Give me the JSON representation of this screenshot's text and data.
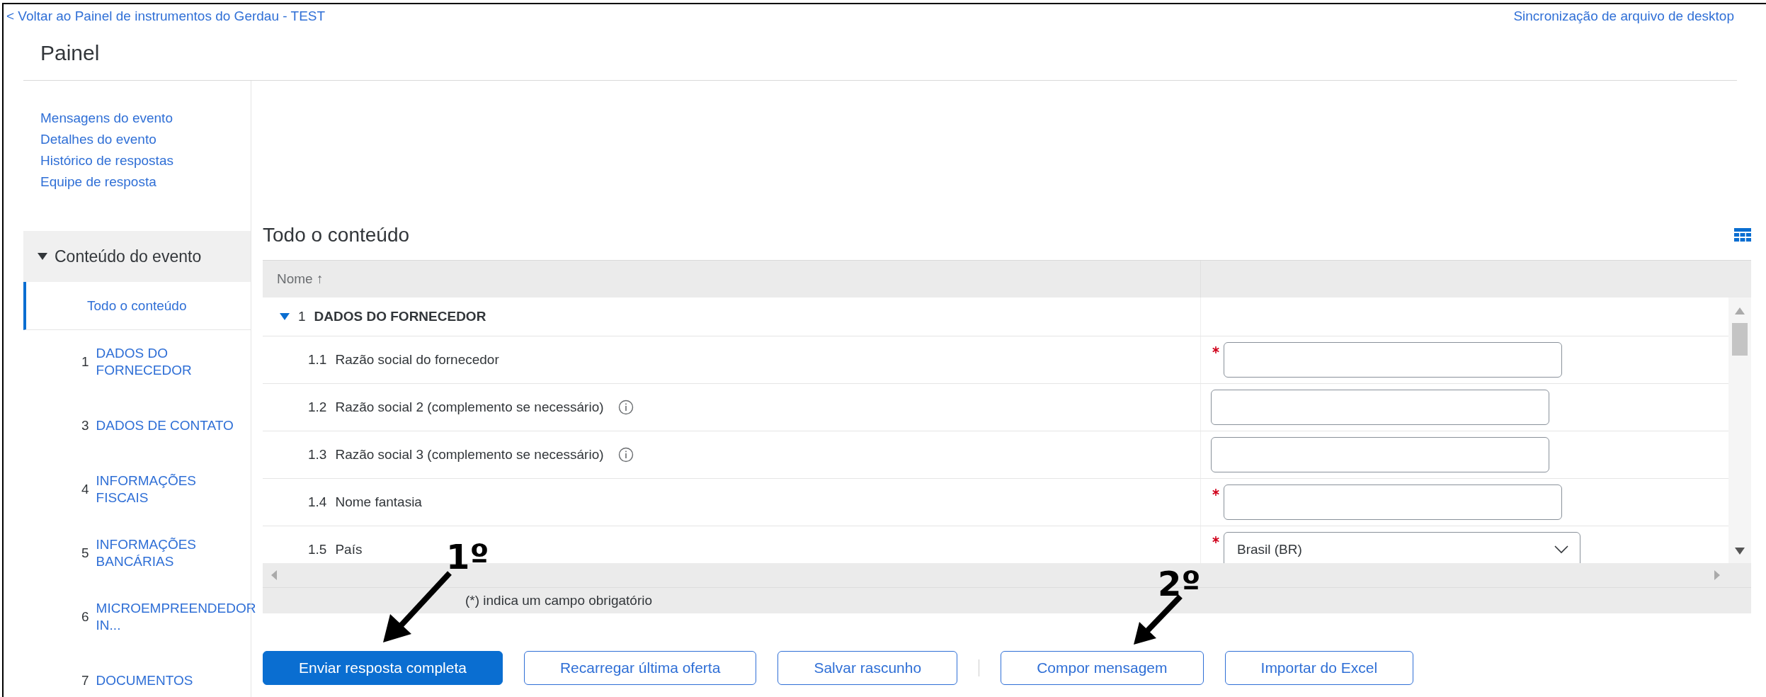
{
  "back_link": "< Voltar ao Painel de instrumentos do Gerdau - TEST",
  "sync_link": "Sincronização de arquivo de desktop",
  "page_title": "Painel",
  "sidebar": {
    "links": [
      "Mensagens do evento",
      "Detalhes do evento",
      "Histórico de respostas",
      "Equipe de resposta"
    ],
    "section": {
      "label": "Conteúdo do evento",
      "expanded": true
    },
    "items": [
      {
        "label": "Todo o conteúdo",
        "selected": true
      },
      {
        "number": "1",
        "label": "DADOS DO FORNECEDOR",
        "selected": false
      },
      {
        "number": "3",
        "label": "DADOS DE CONTATO",
        "selected": false
      },
      {
        "number": "4",
        "label": "INFORMAÇÕES FISCAIS",
        "selected": false
      },
      {
        "number": "5",
        "label": "INFORMAÇÕES BANCÁRIAS",
        "selected": false
      },
      {
        "number": "6",
        "label": "MICROEMPREENDEDOR IN...",
        "selected": false
      },
      {
        "number": "7",
        "label": "DOCUMENTOS",
        "selected": false
      }
    ]
  },
  "content": {
    "title": "Todo o conteúdo",
    "table": {
      "columns": [
        "Nome ↑"
      ],
      "group": {
        "number": "1",
        "label": "DADOS DO FORNECEDOR",
        "expanded": true
      },
      "rows": [
        {
          "number": "1.1",
          "label": "Razão social do fornecedor",
          "info": false,
          "required": true,
          "kind": "text"
        },
        {
          "number": "1.2",
          "label": "Razão social 2 (complemento se necessário)",
          "info": true,
          "required": false,
          "kind": "text"
        },
        {
          "number": "1.3",
          "label": "Razão social 3 (complemento se necessário)",
          "info": true,
          "required": false,
          "kind": "text"
        },
        {
          "number": "1.4",
          "label": "Nome fantasia",
          "info": false,
          "required": true,
          "kind": "text"
        },
        {
          "number": "1.5",
          "label": "País",
          "info": false,
          "required": true,
          "kind": "select",
          "value": "Brasil (BR)"
        }
      ],
      "footer": "(*) indica um campo obrigatório"
    },
    "buttons": [
      {
        "label": "Enviar resposta completa",
        "primary": true
      },
      {
        "label": "Recarregar última oferta",
        "primary": false
      },
      {
        "label": "Salvar rascunho",
        "primary": false
      },
      {
        "label": "Compor mensagem",
        "primary": false
      },
      {
        "label": "Importar do Excel",
        "primary": false
      }
    ]
  },
  "annotations": [
    "1º",
    "2º"
  ]
}
